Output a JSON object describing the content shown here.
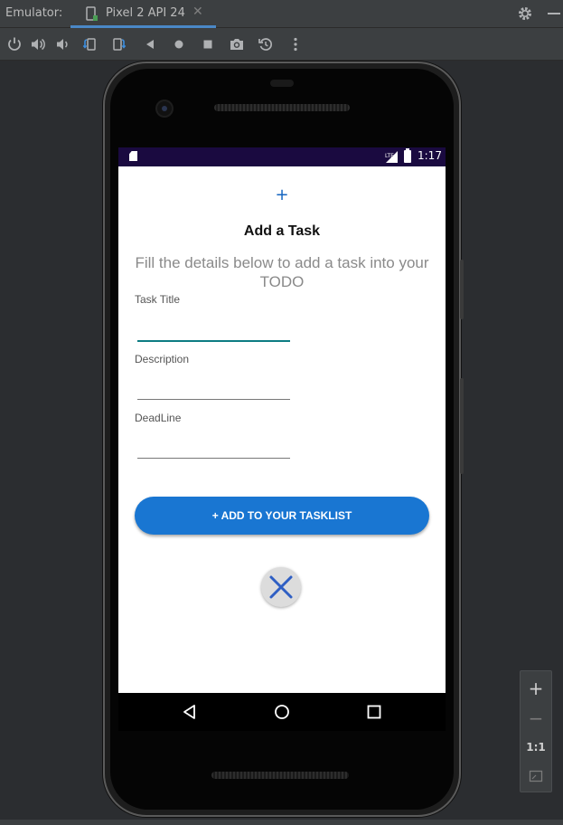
{
  "ide": {
    "emulator_label": "Emulator:",
    "tab_label": "Pixel 2 API 24",
    "tab_close": "✕",
    "icons": [
      "power-icon",
      "volume-up-icon",
      "volume-down-icon",
      "rotate-left-icon",
      "rotate-right-icon",
      "back-icon",
      "home-icon",
      "overview-icon",
      "camera-icon",
      "snapshot-icon",
      "more-icon"
    ]
  },
  "statusbar": {
    "time": "1:17"
  },
  "screen": {
    "plus": "+",
    "title": "Add a Task",
    "subtitle": "Fill the details below to add a task into your TODO",
    "fields": {
      "task_title_label": "Task Title",
      "task_title_value": "",
      "description_label": "Description",
      "description_value": "",
      "deadline_label": "DeadLine",
      "deadline_value": ""
    },
    "add_button": "+ ADD TO YOUR TASKLIST"
  },
  "zoom": {
    "plus": "+",
    "minus": "−",
    "one_to_one": "1:1"
  },
  "colors": {
    "accent": "#1976d2",
    "status_bar": "#1a0a40",
    "focus_underline": "#0d7d83",
    "close_x": "#2f5fc4"
  }
}
